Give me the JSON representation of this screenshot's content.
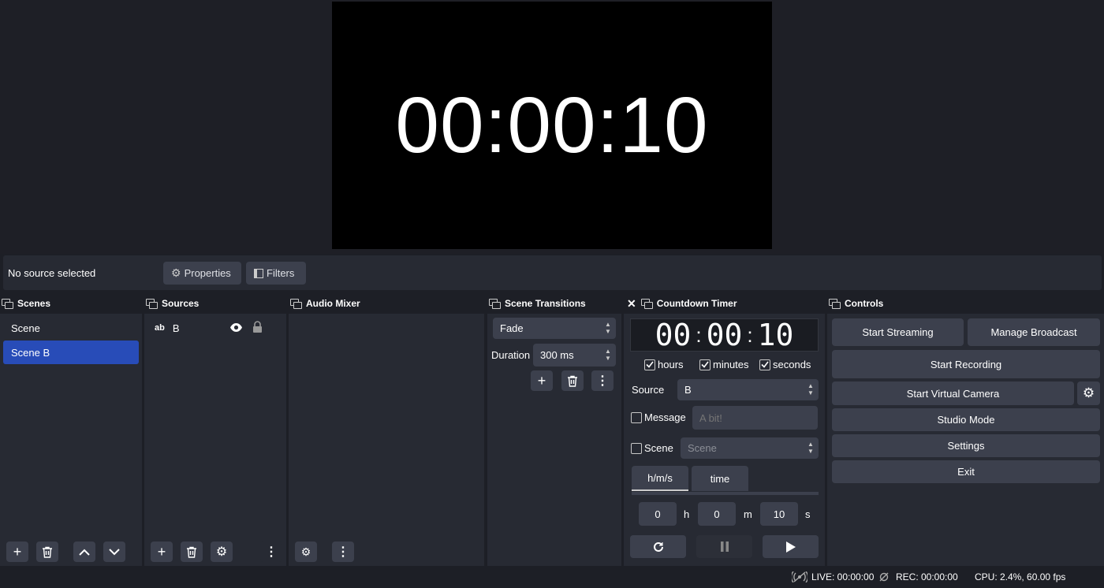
{
  "preview": {
    "timer_text": "00:00:10"
  },
  "context_bar": {
    "status": "No source selected",
    "properties_label": "Properties",
    "filters_label": "Filters"
  },
  "docks": {
    "scenes": {
      "title": "Scenes",
      "items": [
        "Scene",
        "Scene B"
      ],
      "selected": "Scene B"
    },
    "sources": {
      "title": "Sources",
      "items": [
        {
          "type_icon": "ab",
          "name": "B"
        }
      ]
    },
    "audio_mixer": {
      "title": "Audio Mixer"
    },
    "scene_transitions": {
      "title": "Scene Transitions",
      "transition": "Fade",
      "duration_label": "Duration",
      "duration_value": "300 ms"
    },
    "countdown_timer": {
      "title": "Countdown Timer",
      "display": {
        "h": "00",
        "m": "00",
        "s": "10",
        "sep": ":"
      },
      "checkboxes": {
        "hours": "hours",
        "minutes": "minutes",
        "seconds": "seconds"
      },
      "source_label": "Source",
      "source_value": "B",
      "message_label": "Message",
      "message_placeholder": "A bit!",
      "scene_label": "Scene",
      "scene_value": "Scene",
      "tabs": {
        "hms": "h/m/s",
        "time": "time"
      },
      "hours_value": "0",
      "hours_unit": "h",
      "minutes_value": "0",
      "minutes_unit": "m",
      "seconds_value": "10",
      "seconds_unit": "s"
    },
    "controls": {
      "title": "Controls",
      "start_streaming": "Start Streaming",
      "manage_broadcast": "Manage Broadcast",
      "start_recording": "Start Recording",
      "start_virtual_camera": "Start Virtual Camera",
      "studio_mode": "Studio Mode",
      "settings": "Settings",
      "exit": "Exit"
    }
  },
  "status_bar": {
    "live": "LIVE: 00:00:00",
    "rec": "REC: 00:00:00",
    "cpu": "CPU: 2.4%, 60.00 fps"
  },
  "colors": {
    "accent": "#284cb8",
    "panel": "#272a33",
    "button": "#3c404d",
    "background": "#1d1f26"
  }
}
